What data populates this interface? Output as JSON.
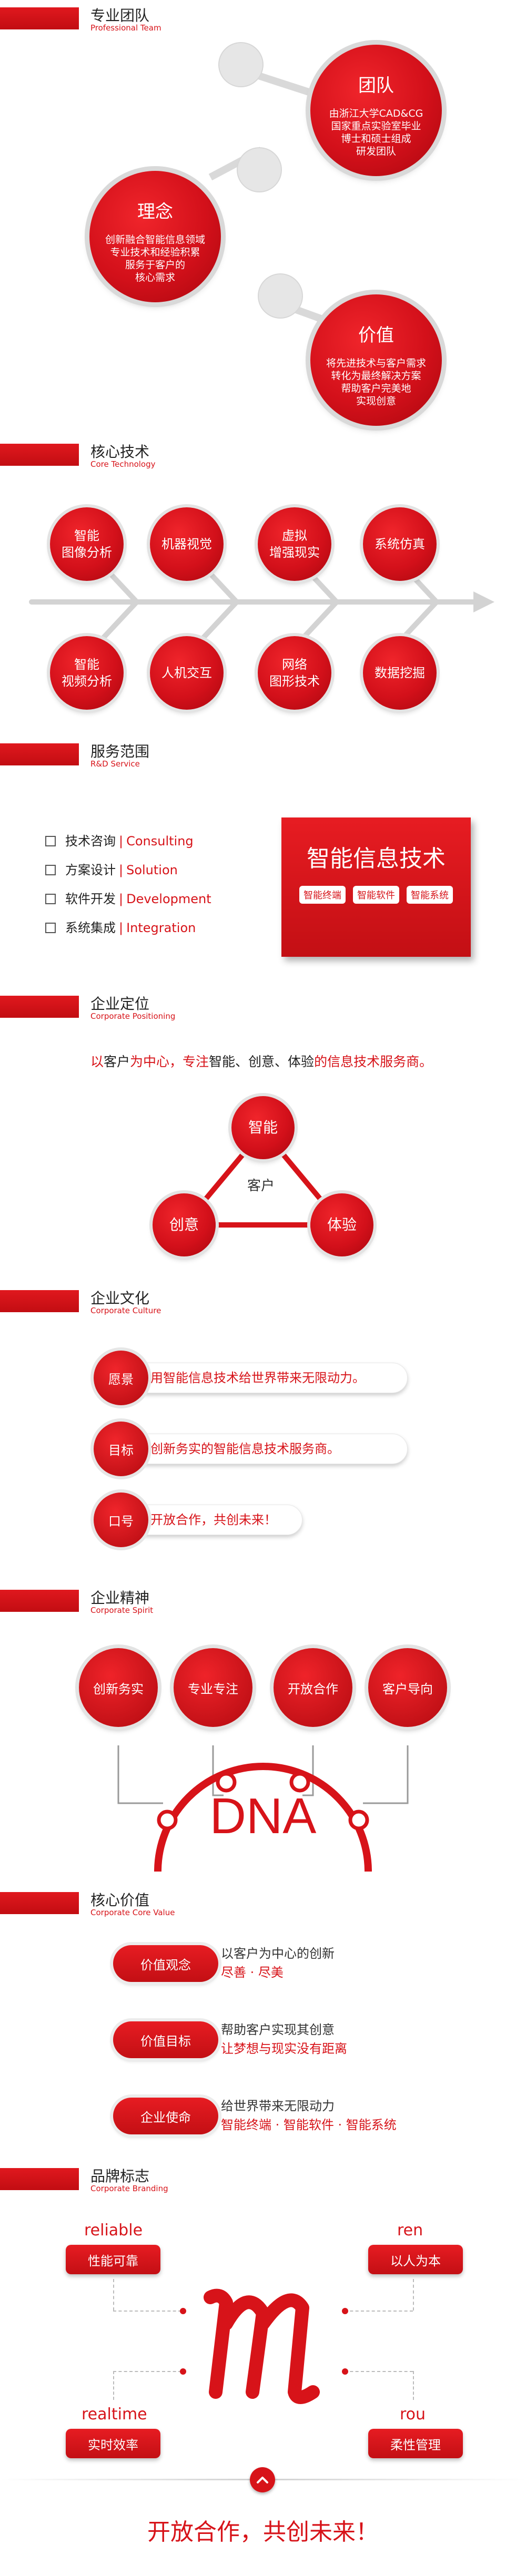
{
  "sections": {
    "team": {
      "title": "专业团队",
      "sub": "Professional Team"
    },
    "tech": {
      "title": "核心技术",
      "sub": "Core Technology"
    },
    "service": {
      "title": "服务范围",
      "sub": "R&D Service"
    },
    "position": {
      "title": "企业定位",
      "sub": "Corporate Positioning"
    },
    "culture": {
      "title": "企业文化",
      "sub": "Corporate Culture"
    },
    "spirit": {
      "title": "企业精神",
      "sub": "Corporate Spirit"
    },
    "values": {
      "title": "核心价值",
      "sub": "Corporate Core Value"
    },
    "brand": {
      "title": "品牌标志",
      "sub": "Corporate Branding"
    }
  },
  "team": [
    {
      "title": "团队",
      "lines": [
        "由浙江大学CAD&CG",
        "国家重点实验室毕业",
        "博士和硕士组成",
        "研发团队"
      ]
    },
    {
      "title": "理念",
      "lines": [
        "创新融合智能信息领域",
        "专业技术和经验积累",
        "服务于客户的",
        "核心需求"
      ]
    },
    {
      "title": "价值",
      "lines": [
        "将先进技术与客户需求",
        "转化为最终解决方案",
        "帮助客户完美地",
        "实现创意"
      ]
    }
  ],
  "tech": [
    {
      "l1": "智能",
      "l2": "图像分析"
    },
    {
      "l1": "机器视觉",
      "l2": ""
    },
    {
      "l1": "虚拟",
      "l2": "增强现实"
    },
    {
      "l1": "系统仿真",
      "l2": ""
    },
    {
      "l1": "智能",
      "l2": "视频分析"
    },
    {
      "l1": "人机交互",
      "l2": ""
    },
    {
      "l1": "网络",
      "l2": "图形技术"
    },
    {
      "l1": "数据挖掘",
      "l2": ""
    }
  ],
  "service": {
    "rows": [
      {
        "cn": "技术咨询",
        "sep": "|",
        "en": "Consulting"
      },
      {
        "cn": "方案设计",
        "sep": "|",
        "en": "Solution"
      },
      {
        "cn": "软件开发",
        "sep": "|",
        "en": "Development"
      },
      {
        "cn": "系统集成",
        "sep": "|",
        "en": "Integration"
      }
    ],
    "card_title": "智能信息技术",
    "tags": [
      "智能终端",
      "智能软件",
      "智能系统"
    ]
  },
  "position": {
    "t1": "以",
    "t2": "客户",
    "t3": "为中心，专注",
    "t4": "智能、创意、体验",
    "t5": "的信息技术服务商。",
    "center": "客户",
    "nodes": [
      "智能",
      "创意",
      "体验"
    ]
  },
  "culture": [
    {
      "label": "愿景",
      "text": "用智能信息技术给世界带来无限动力。"
    },
    {
      "label": "目标",
      "text": "创新务实的智能信息技术服务商。"
    },
    {
      "label": "口号",
      "text": "开放合作，共创未来！"
    }
  ],
  "spirit": {
    "items": [
      "创新务实",
      "专业专注",
      "开放合作",
      "客户导向"
    ],
    "dna": "DNA"
  },
  "values": [
    {
      "label": "价值观念",
      "a": "以客户为中心的创新",
      "b": "尽善 · 尽美"
    },
    {
      "label": "价值目标",
      "a": "帮助客户实现其创意",
      "b": "让梦想与现实没有距离"
    },
    {
      "label": "企业使命",
      "a": "给世界带来无限动力",
      "b": "智能终端 · 智能软件 · 智能系统"
    }
  ],
  "brand": {
    "items": [
      {
        "en": "reliable",
        "cn": "性能可靠"
      },
      {
        "en": "ren",
        "cn": "以人为本"
      },
      {
        "en": "realtime",
        "cn": "实时效率"
      },
      {
        "en": "rou",
        "cn": "柔性管理"
      }
    ],
    "slogan": "开放合作，共创未来！",
    "up_icon": "chevron-up-icon"
  },
  "colors": {
    "accent": "#d71319",
    "gray": "#d9d9d9"
  }
}
